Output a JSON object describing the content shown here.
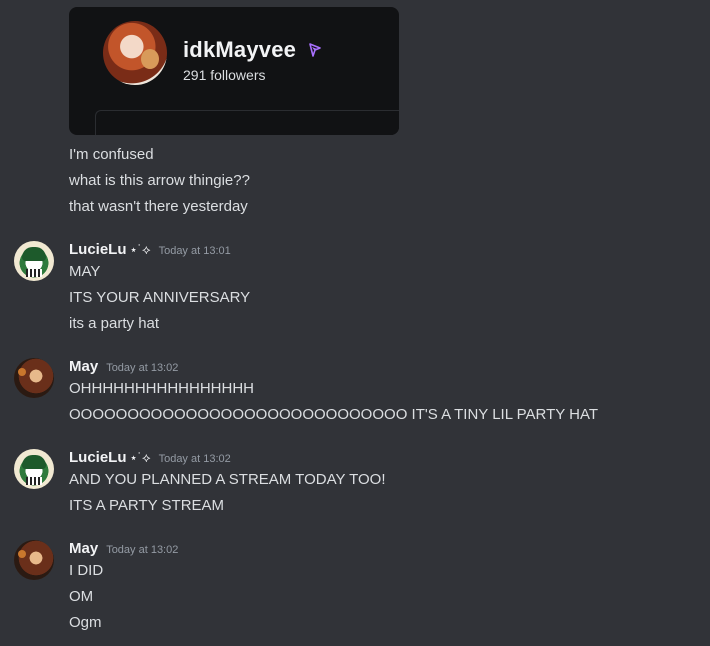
{
  "embed": {
    "name": "idkMayvee",
    "followers": "291 followers",
    "verified_icon": "verified-badge-icon",
    "accent_color": "#a970ff"
  },
  "continuation_lines": [
    "I'm confused",
    "what is this arrow thingie??",
    "that wasn't there yesterday"
  ],
  "messages": [
    {
      "author": "LucieLu",
      "badge": "⋆˙⟡",
      "timestamp": "Today at 13:01",
      "lines": [
        "MAY",
        "ITS YOUR ANNIVERSARY",
        "its a party hat"
      ]
    },
    {
      "author": "May",
      "badge": "",
      "timestamp": "Today at 13:02",
      "lines": [
        "OHHHHHHHHHHHHHHHH",
        "OOOOOOOOOOOOOOOOOOOOOOOOOOOOO IT'S A TINY LIL PARTY HAT"
      ]
    },
    {
      "author": "LucieLu",
      "badge": "⋆˙⟡",
      "timestamp": "Today at 13:02",
      "lines": [
        "AND YOU PLANNED A STREAM TODAY TOO!",
        "ITS A PARTY STREAM"
      ]
    },
    {
      "author": "May",
      "badge": "",
      "timestamp": "Today at 13:02",
      "lines": [
        "I DID",
        "OM",
        "Ogm"
      ]
    }
  ]
}
